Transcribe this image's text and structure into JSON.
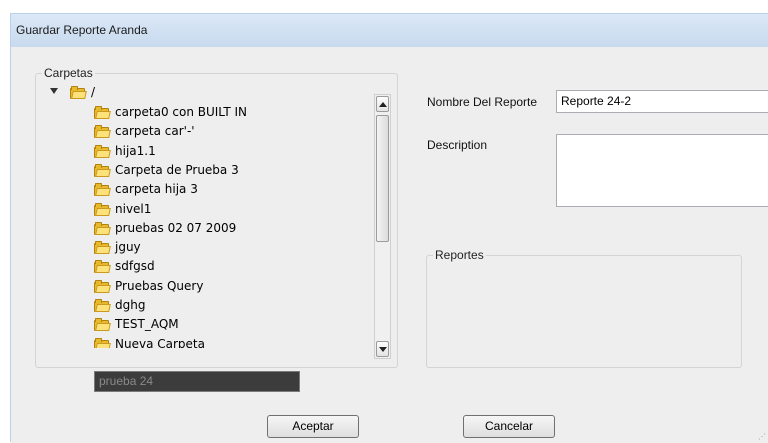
{
  "window": {
    "title": "Guardar Reporte Aranda"
  },
  "folders": {
    "legend": "Carpetas",
    "root_label": "/",
    "items": [
      "carpeta0 con BUILT IN",
      "carpeta car'-'",
      "hija1.1",
      "Carpeta de Prueba 3",
      "carpeta hija 3",
      "nivel1",
      "pruebas 02 07 2009",
      "jguy",
      "sdfgsd",
      "Pruebas Query",
      "dghg",
      "TEST_AQM",
      "Nueva Carpeta"
    ],
    "rename_value": "prueba 24"
  },
  "form": {
    "name_label": "Nombre Del Reporte",
    "name_value": "Reporte 24-2",
    "description_label": "Description",
    "description_value": "",
    "reports_legend": "Reportes"
  },
  "buttons": {
    "accept": "Aceptar",
    "cancel": "Cancelar"
  }
}
